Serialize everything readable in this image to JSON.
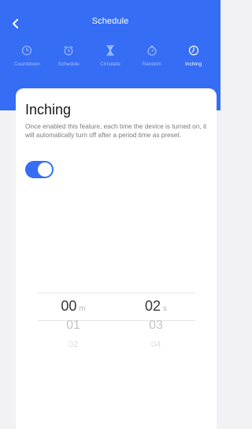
{
  "header": {
    "title": "Schedule",
    "bg_color": "#356df4"
  },
  "modes": [
    {
      "label": "Countdown",
      "icon": "countdown-clock-icon"
    },
    {
      "label": "Schedule",
      "icon": "alarm-clock-icon"
    },
    {
      "label": "Circulate",
      "icon": "hourglass-icon"
    },
    {
      "label": "Random",
      "icon": "stopwatch-icon"
    },
    {
      "label": "Inching",
      "icon": "inching-clock-icon",
      "active": true
    }
  ],
  "card": {
    "title": "Inching",
    "description": "Once enabled this feature,  each time the device is turned on, it will automatically turn off after a period time as preset.",
    "toggle_on": true
  },
  "picker": {
    "minutes": {
      "selected": "00",
      "unit": "m",
      "next": "01",
      "next2": "02"
    },
    "seconds": {
      "selected": "02",
      "unit": "s",
      "next": "03",
      "next2": "04"
    }
  }
}
